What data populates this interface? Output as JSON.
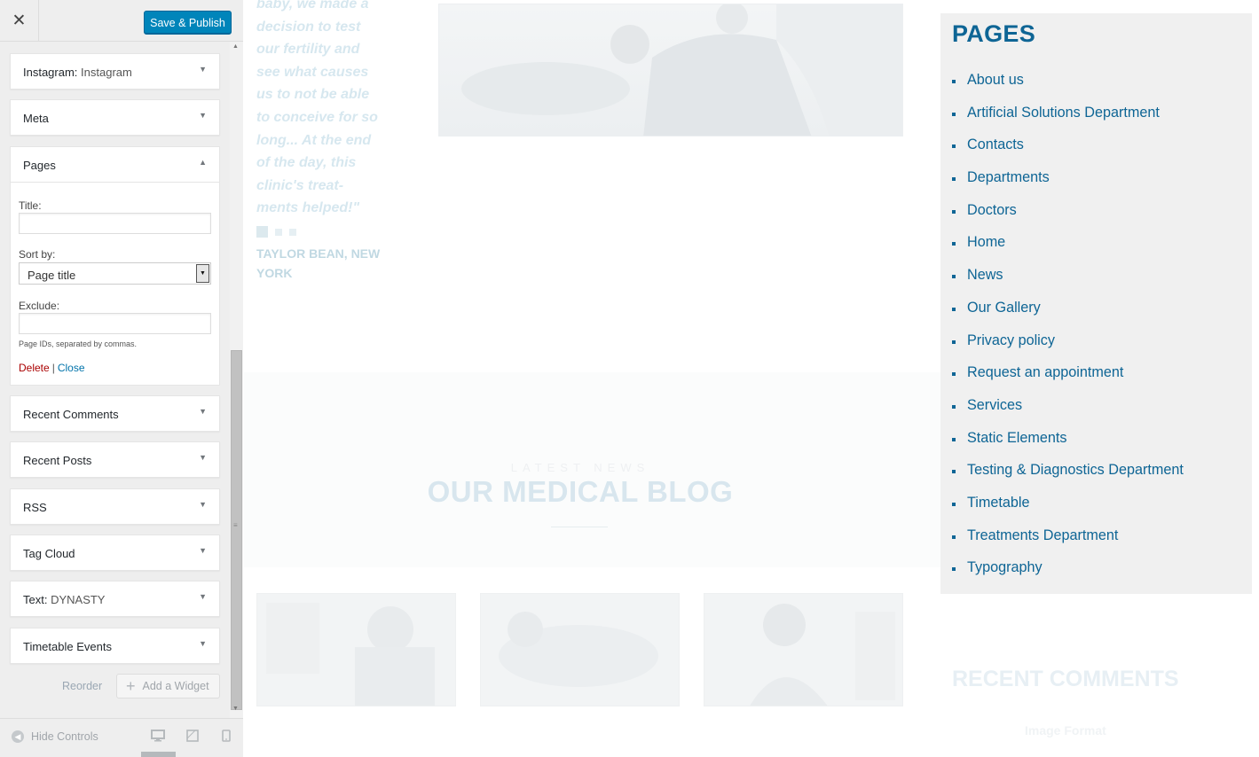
{
  "customizer": {
    "close_glyph": "✕",
    "publish_label": "Save & Publish",
    "widgets_top": [
      {
        "title": "Instagram:",
        "sub": " Instagram"
      },
      {
        "title": "Meta",
        "sub": ""
      }
    ],
    "pages_widget": {
      "title": "Pages",
      "title_label": "Title:",
      "title_value": "",
      "sortby_label": "Sort by:",
      "sortby_value": "Page title",
      "exclude_label": "Exclude:",
      "exclude_value": "",
      "exclude_note": "Page IDs, separated by commas.",
      "delete_label": "Delete",
      "separator": "|",
      "close_label": "Close"
    },
    "widgets_bottom": [
      {
        "title": "Recent Comments",
        "sub": ""
      },
      {
        "title": "Recent Posts",
        "sub": ""
      },
      {
        "title": "RSS",
        "sub": ""
      },
      {
        "title": "Tag Cloud",
        "sub": ""
      },
      {
        "title": "Text:",
        "sub": " DYNASTY"
      },
      {
        "title": "Timetable Events",
        "sub": ""
      }
    ],
    "reorder_label": "Reorder",
    "add_widget_label": "Add a Widget",
    "hide_controls_label": "Hide Controls",
    "icons": {
      "close": "close-icon",
      "expand": "triangle-down-icon",
      "collapse": "triangle-up-icon",
      "add": "plus-icon",
      "hide": "arrow-left-circle-icon",
      "desktop": "desktop-icon",
      "tablet": "tablet-icon",
      "mobile": "mobile-icon"
    },
    "accent_color": "#0085ba"
  },
  "preview": {
    "testimonial_text": "baby, we made a decision to test our fertility and see what causes us to not be able to conceive for so long... At the end of the day, this clinic's treat-ments helped!\"",
    "testimonial_author": "TAYLOR BEAN, NEW YORK",
    "blog_eyebrow": "LATEST NEWS",
    "blog_title": "OUR MEDICAL BLOG",
    "pages_title": "PAGES",
    "pages": [
      "About us",
      "Artificial Solutions Department",
      "Contacts",
      "Departments",
      "Doctors",
      "Home",
      "News",
      "Our Gallery",
      "Privacy policy",
      "Request an appointment",
      "Services",
      "Static Elements",
      "Testing & Diagnostics Department",
      "Timetable",
      "Treatments Department",
      "Typography"
    ],
    "recent_comments_title": "RECENT COMMENTS",
    "recent_comment_link": "Image Format",
    "link_color": "#0e6595"
  }
}
